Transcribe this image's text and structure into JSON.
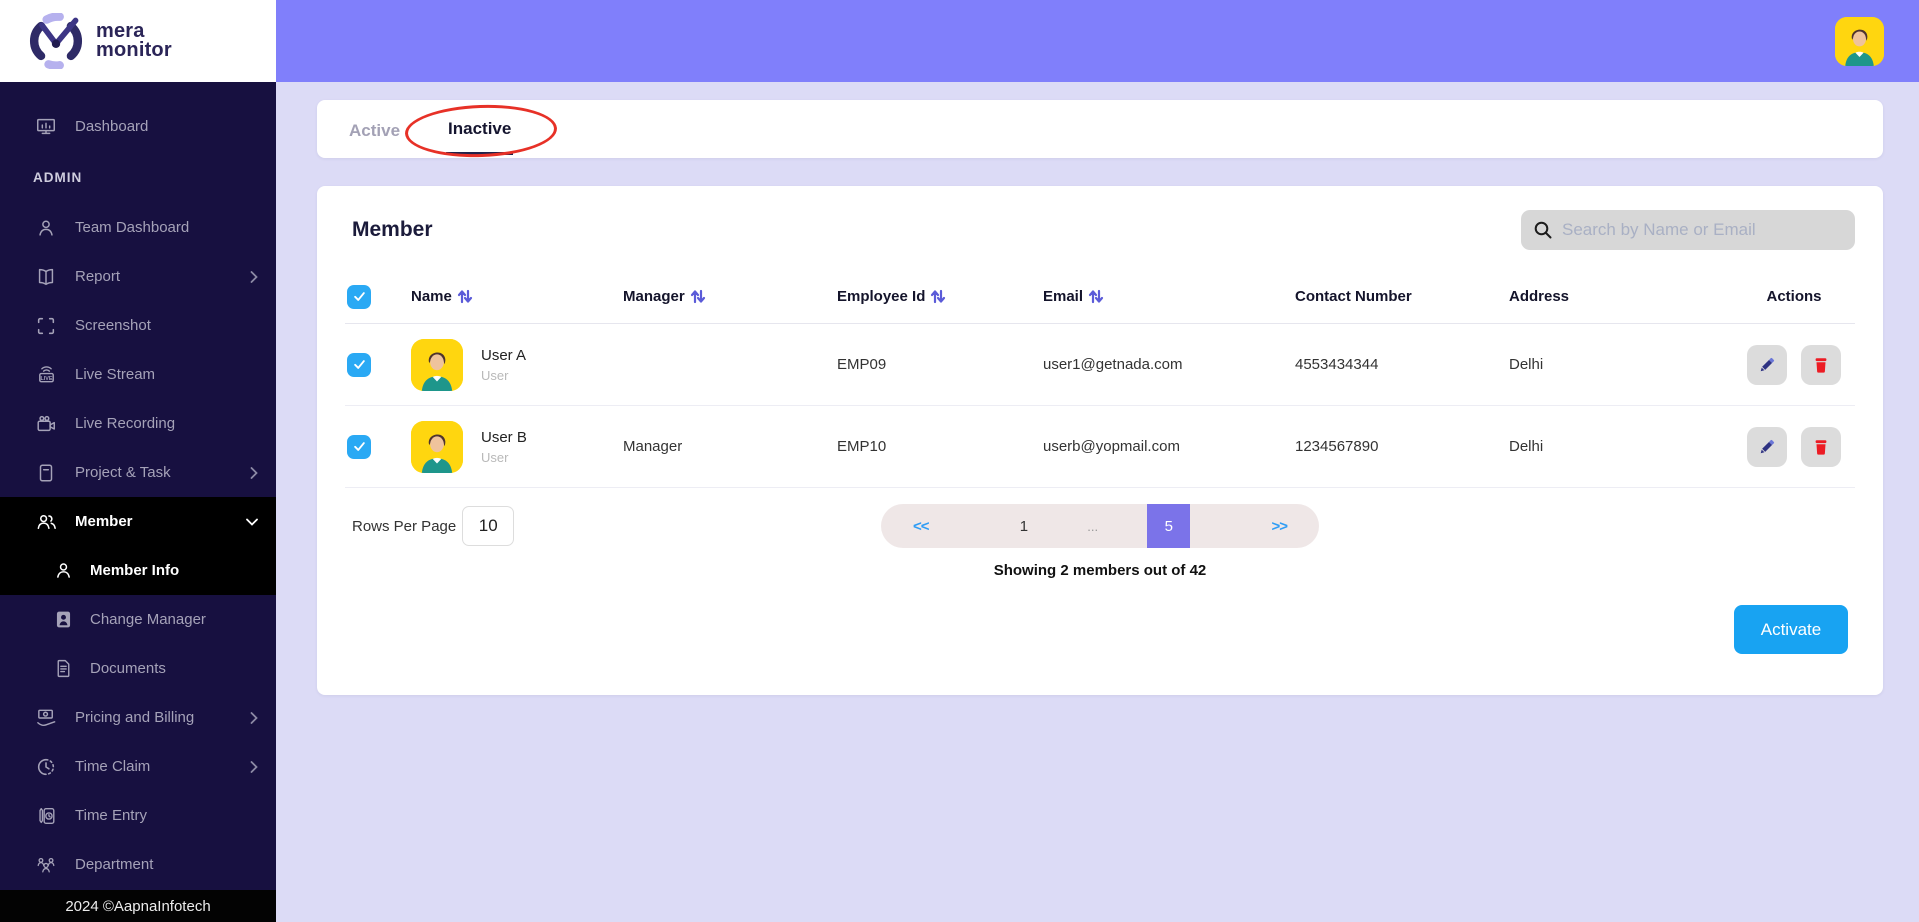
{
  "brand": {
    "line1": "mera",
    "line2": "monitor"
  },
  "topbar": {
    "avatar_icon": "user-avatar-icon"
  },
  "sidebar": {
    "items": [
      {
        "label": "Dashboard",
        "icon": "dashboard-icon"
      },
      {
        "label": "ADMIN",
        "icon": null,
        "type": "section"
      },
      {
        "label": "Team Dashboard",
        "icon": "team-dashboard-icon"
      },
      {
        "label": "Report",
        "icon": "report-icon",
        "chevron": "right"
      },
      {
        "label": "Screenshot",
        "icon": "screenshot-icon"
      },
      {
        "label": "Live Stream",
        "icon": "live-stream-icon"
      },
      {
        "label": "Live Recording",
        "icon": "live-recording-icon"
      },
      {
        "label": "Project & Task",
        "icon": "project-task-icon",
        "chevron": "right"
      },
      {
        "label": "Member",
        "icon": "member-icon",
        "chevron": "down",
        "selected": true
      },
      {
        "label": "Member Info",
        "icon": "member-info-icon",
        "selected": true,
        "sub": true
      },
      {
        "label": "Change Manager",
        "icon": "change-manager-icon",
        "sub": true
      },
      {
        "label": "Documents",
        "icon": "documents-icon",
        "sub": true
      },
      {
        "label": "Pricing and Billing",
        "icon": "pricing-billing-icon",
        "chevron": "right"
      },
      {
        "label": "Time Claim",
        "icon": "time-claim-icon",
        "chevron": "right"
      },
      {
        "label": "Time Entry",
        "icon": "time-entry-icon"
      },
      {
        "label": "Department",
        "icon": "department-icon"
      }
    ],
    "footer": "2024 ©AapnaInfotech"
  },
  "tabs": {
    "active_label": "Active",
    "inactive_label": "Inactive",
    "selected": "Inactive"
  },
  "member_panel": {
    "title": "Member",
    "search_placeholder": "Search by Name or Email",
    "table": {
      "columns": [
        "Name",
        "Manager",
        "Employee Id",
        "Email",
        "Contact Number",
        "Address",
        "Actions"
      ],
      "sortable_columns": [
        "Name",
        "Manager",
        "Employee Id",
        "Email"
      ],
      "rows": [
        {
          "name": "User A",
          "role": "User",
          "manager": "",
          "employee_id": "EMP09",
          "email": "user1@getnada.com",
          "contact": "4553434344",
          "address": "Delhi",
          "checked": true,
          "actions": [
            "edit",
            "delete"
          ]
        },
        {
          "name": "User B",
          "role": "User",
          "manager": "Manager",
          "employee_id": "EMP10",
          "email": "userb@yopmail.com",
          "contact": "1234567890",
          "address": "Delhi",
          "checked": true,
          "actions": [
            "edit",
            "delete"
          ]
        }
      ]
    },
    "pagination": {
      "rows_per_page_label": "Rows Per Page",
      "rows_per_page_value": "10",
      "prev_label": "<<",
      "page_one": "1",
      "ellipsis": "...",
      "current_page": "5",
      "next_label": ">>",
      "summary": "Showing 2 members out of 42"
    },
    "activate_label": "Activate"
  },
  "colors": {
    "topbar_purple": "#807ffb",
    "sidebar_navy": "#171040",
    "selected_black": "#000000",
    "background_lavender": "#dcdbf6",
    "checkbox_blue": "#2aa9f4",
    "activate_blue": "#18a3f2",
    "pager_active_purple": "#7b73e9",
    "pager_arrow_blue": "#2f9df5",
    "annotation_red": "#e73127",
    "avatar_yellow": "#ffd60f",
    "edit_pencil_navy": "#2e3282",
    "delete_trash_red": "#ec1c24",
    "sort_arrow_purple": "#5b5bd8"
  }
}
